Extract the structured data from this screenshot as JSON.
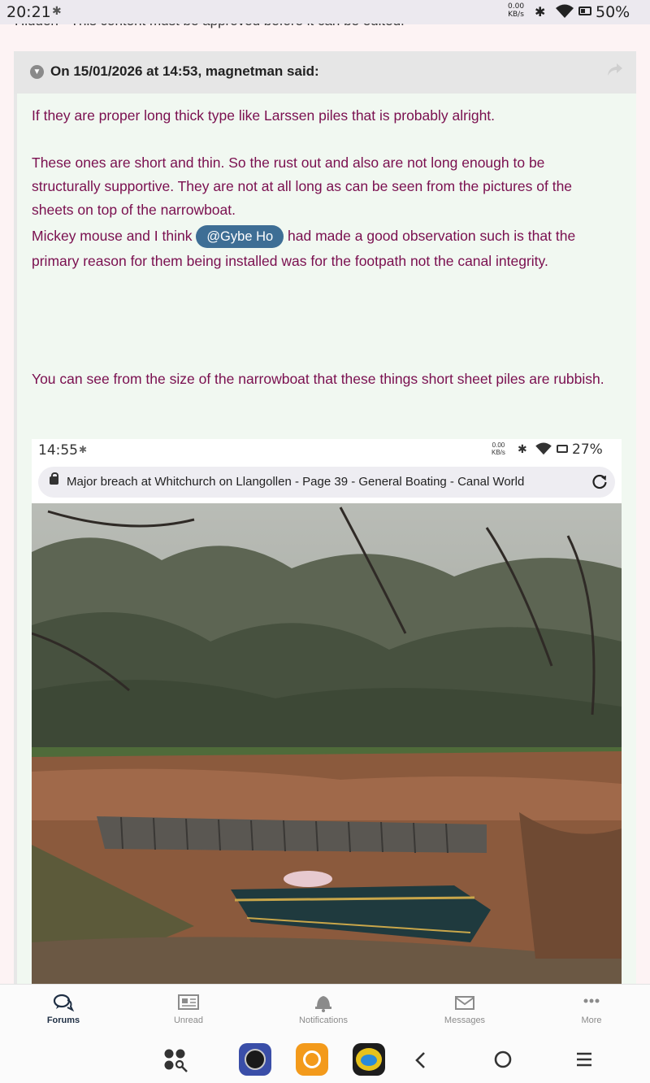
{
  "status_bar": {
    "time": "20:21",
    "data_rate_value": "0.00",
    "data_rate_unit": "KB/s",
    "battery": "50%"
  },
  "hidden_note": "Hidden - This content must be approved before it can be edited.",
  "quote": {
    "attribution": "On 15/01/2026 at 14:53, magnetman said:",
    "paragraphs": {
      "p1": "If they are proper long thick type like Larssen piles that is probably alright.",
      "p2": "These ones are short and thin. So the rust out and also are not long enough to be structurally supportive. They are not at all long as can be seen from the pictures of the sheets on top of the narrowboat.",
      "p3_before": "Mickey mouse and I think ",
      "p3_mention": "@Gybe Ho",
      "p3_after": " had made a good observation such is that the primary reason for them being installed was for the footpath not the canal integrity.",
      "p4": "You can see from the size of the narrowboat that these things short sheet piles are rubbish."
    },
    "text_color": "#7a0f4f",
    "mention_color": "#3e6e95"
  },
  "embedded_screenshot": {
    "time": "14:55",
    "data_rate_value": "0.00",
    "data_rate_unit": "KB/s",
    "battery": "27%",
    "page_title": "Major breach at Whitchurch on Llangollen - Page 39 - General Boating - Canal World"
  },
  "tab_bar": {
    "tabs": [
      {
        "label": "Forums",
        "icon": "chat-bubbles-icon",
        "active": true
      },
      {
        "label": "Unread",
        "icon": "newspaper-icon",
        "active": false
      },
      {
        "label": "Notifications",
        "icon": "bell-icon",
        "active": false
      },
      {
        "label": "Messages",
        "icon": "envelope-icon",
        "active": false
      },
      {
        "label": "More",
        "icon": "ellipsis-icon",
        "active": false
      }
    ]
  }
}
